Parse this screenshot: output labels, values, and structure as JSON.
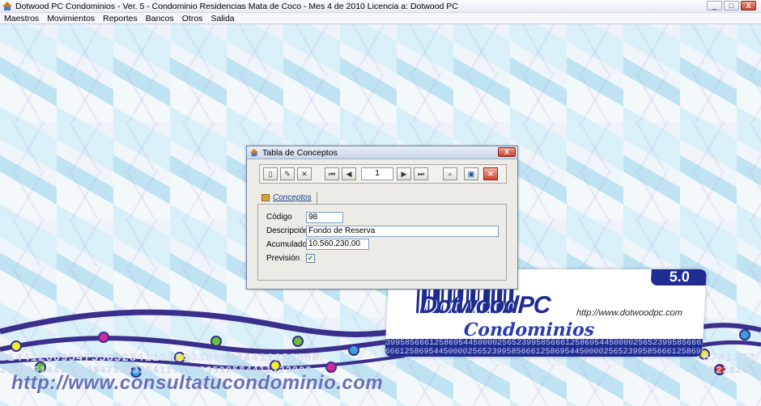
{
  "window": {
    "title": "Dotwood PC Condominios - Ver. 5  - Condominio Residencias Mata de Coco  -  Mes 4 de 2010     Licencia a: Dotwood PC",
    "controls": [
      "_",
      "□",
      "X"
    ]
  },
  "menu": {
    "items": [
      "Maestros",
      "Movimientos",
      "Reportes",
      "Bancos",
      "Otros",
      "Salida"
    ]
  },
  "dialog": {
    "title": "Tabla de Conceptos",
    "close_glyph": "X",
    "toolbar": {
      "record_number": "1"
    },
    "tab_label": "Conceptos",
    "fields": {
      "codigo_label": "Código",
      "codigo_value": "98",
      "descripcion_label": "Descripción",
      "descripcion_value": "Fondo de Reserva",
      "acumulado_label": "Acumulado",
      "acumulado_value": "10.560.230,00",
      "prevision_label": "Previsión",
      "prevision_checked": true
    }
  },
  "branding": {
    "logo_text": "DotwoodPC",
    "logo_subtitle": "Condominios",
    "logo_url": "http://www.dotwoodpc.com",
    "version": "5.0",
    "website": "http://www.consultatucondominio.com",
    "digits_line_1": "614412669547358325411521533599584411122008",
    "digits_line_2": "24585614412669547358325411521533599584411122008",
    "logo_digits_1": "3995856661258695445000025652399585666125869544500002565239958566612586954450000256523995856",
    "logo_digits_2": "6661258695445000025652399585666125869544500002565239958566612586954450000256523995856",
    "right_digits_1": "5741232",
    "right_digits_2": "522820"
  },
  "colors": {
    "brand_blue": "#1f2d92",
    "wave_purple": "#3a2f8c"
  }
}
